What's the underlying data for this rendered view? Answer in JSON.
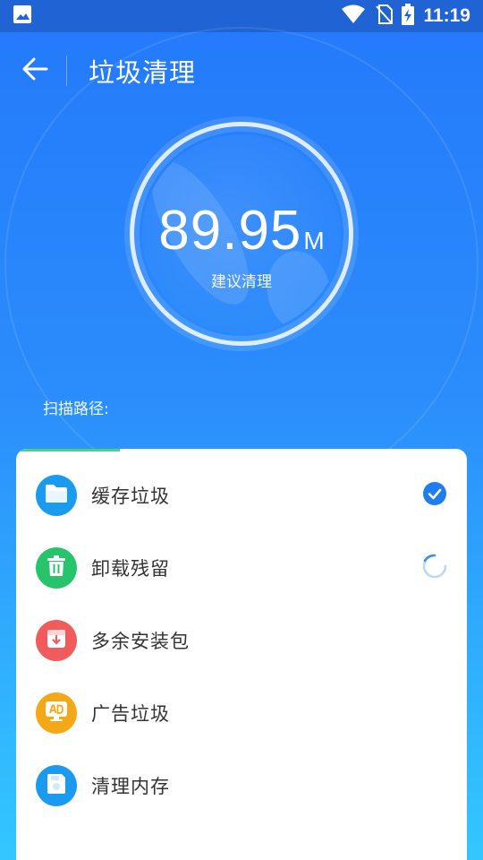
{
  "status_bar": {
    "time": "11:19",
    "icons": [
      "image-icon",
      "wifi-icon",
      "no-sim-icon",
      "battery-charging-icon"
    ]
  },
  "header": {
    "title": "垃圾清理",
    "back_icon": "arrow-left-icon"
  },
  "gauge": {
    "value": "89.95",
    "unit": "M",
    "caption": "建议清理"
  },
  "scan": {
    "label": "扫描路径:",
    "progress": 0.23
  },
  "items": [
    {
      "label": "缓存垃圾",
      "icon": "folder-icon",
      "color": "#1a9bf0",
      "status": "done"
    },
    {
      "label": "卸载残留",
      "icon": "trash-icon",
      "color": "#27c46b",
      "status": "scanning"
    },
    {
      "label": "多余安装包",
      "icon": "package-icon",
      "color": "#f05b5b",
      "status": "pending"
    },
    {
      "label": "广告垃圾",
      "icon": "ad-icon",
      "color": "#f5a817",
      "status": "pending"
    },
    {
      "label": "清理内存",
      "icon": "memory-card-icon",
      "color": "#1a9bf0",
      "status": "pending"
    }
  ],
  "colors": {
    "accent": "#2479fb",
    "check": "#1e7ef0",
    "progress": "#4ad47a"
  }
}
